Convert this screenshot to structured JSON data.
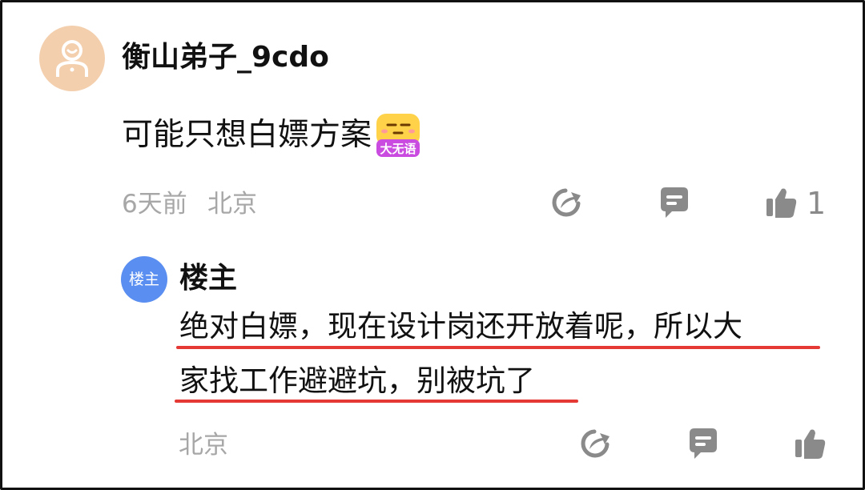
{
  "comment": {
    "username": "衡山弟子_9cdo",
    "text": "可能只想白嫖方案",
    "sticker_label": "大无语",
    "time": "6天前",
    "location": "北京",
    "like_count": "1"
  },
  "reply": {
    "badge": "楼主",
    "author": "楼主",
    "lines": [
      "绝对白嫖，现在设计岗还开放着呢，所以大",
      "家找工作避避坑，别被坑了"
    ],
    "location": "北京"
  },
  "colors": {
    "avatar_bg": "#f3cfae",
    "badge_bg": "#5a8ef0",
    "meta_text": "#a7a7a7",
    "icon": "#8a8a8a",
    "underline": "#e53935"
  },
  "icons": [
    "share-icon",
    "reply-icon",
    "thumbs-up-icon"
  ]
}
